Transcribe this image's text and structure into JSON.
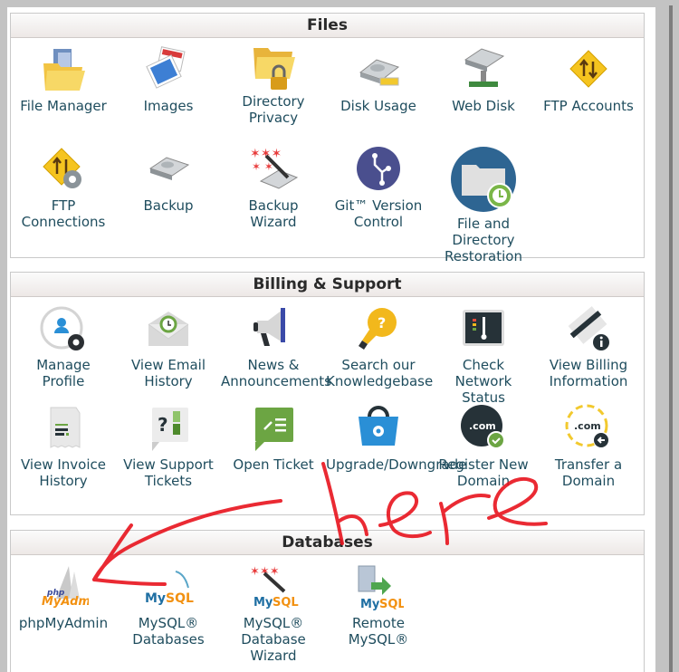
{
  "sections": {
    "files": {
      "title": "Files",
      "items": [
        {
          "label_lines": [
            "File Manager"
          ],
          "icon": "folder-icon"
        },
        {
          "label_lines": [
            "Images"
          ],
          "icon": "images-icon"
        },
        {
          "label_lines": [
            "Directory",
            "Privacy"
          ],
          "icon": "folder-lock-icon"
        },
        {
          "label_lines": [
            "Disk Usage"
          ],
          "icon": "disk-usage-icon"
        },
        {
          "label_lines": [
            "Web Disk"
          ],
          "icon": "web-disk-icon"
        },
        {
          "label_lines": [
            "FTP Accounts"
          ],
          "icon": "ftp-icon"
        },
        {
          "label_lines": [
            "FTP",
            "Connections"
          ],
          "icon": "ftp-gear-icon"
        },
        {
          "label_lines": [
            "Backup"
          ],
          "icon": "hard-drive-icon"
        },
        {
          "label_lines": [
            "Backup",
            "Wizard"
          ],
          "icon": "backup-wizard-icon"
        },
        {
          "label_lines": [
            "Git™ Version",
            "Control"
          ],
          "icon": "git-icon"
        },
        {
          "label_lines": [
            "File and",
            "Directory",
            "Restoration"
          ],
          "icon": "restore-folder-icon"
        }
      ]
    },
    "billing": {
      "title": "Billing & Support",
      "items": [
        {
          "label_lines": [
            "Manage",
            "Profile"
          ],
          "icon": "profile-gear-icon"
        },
        {
          "label_lines": [
            "View Email",
            "History"
          ],
          "icon": "email-history-icon"
        },
        {
          "label_lines": [
            "News &",
            "Announcements"
          ],
          "icon": "megaphone-icon"
        },
        {
          "label_lines": [
            "Search our",
            "Knowledgebase"
          ],
          "icon": "lightbulb-icon"
        },
        {
          "label_lines": [
            "Check",
            "Network",
            "Status"
          ],
          "icon": "network-status-icon"
        },
        {
          "label_lines": [
            "View Billing",
            "Information"
          ],
          "icon": "credit-card-info-icon"
        },
        {
          "label_lines": [
            "View Invoice",
            "History"
          ],
          "icon": "invoice-icon"
        },
        {
          "label_lines": [
            "View Support",
            "Tickets"
          ],
          "icon": "support-tickets-icon"
        },
        {
          "label_lines": [
            "Open Ticket"
          ],
          "icon": "open-ticket-icon"
        },
        {
          "label_lines": [
            "Upgrade/Downgrade"
          ],
          "icon": "shopping-bag-gear-icon"
        },
        {
          "label_lines": [
            "Register New",
            "Domain"
          ],
          "icon": "domain-register-icon"
        },
        {
          "label_lines": [
            "Transfer a",
            "Domain"
          ],
          "icon": "domain-transfer-icon"
        }
      ]
    },
    "databases": {
      "title": "Databases",
      "items": [
        {
          "label_lines": [
            "phpMyAdmin"
          ],
          "icon": "phpmyadmin-icon"
        },
        {
          "label_lines": [
            "MySQL®",
            "Databases"
          ],
          "icon": "mysql-icon"
        },
        {
          "label_lines": [
            "MySQL®",
            "Database",
            "Wizard"
          ],
          "icon": "mysql-wizard-icon"
        },
        {
          "label_lines": [
            "Remote",
            "MySQL®"
          ],
          "icon": "remote-mysql-icon"
        }
      ]
    }
  },
  "annotation": {
    "text": "here",
    "color": "#e8141e",
    "points_to": "phpMyAdmin"
  }
}
